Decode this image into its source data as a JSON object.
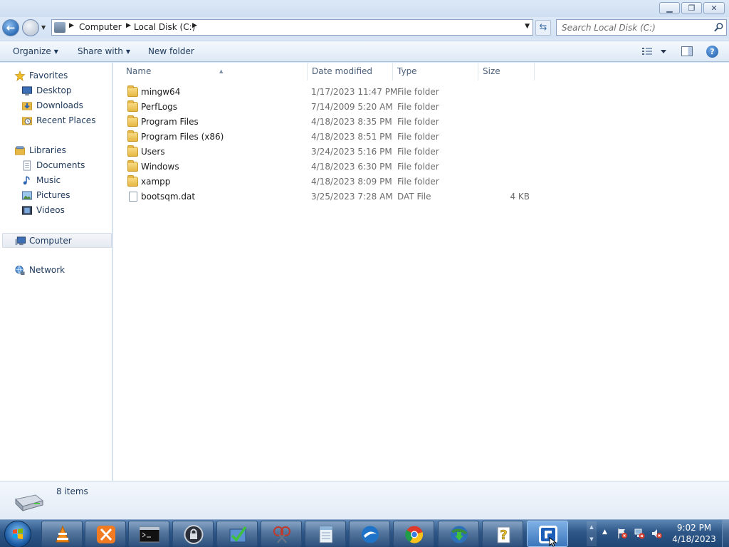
{
  "window": {
    "min_glyph": "▁",
    "max_glyph": "❐",
    "close_glyph": "✕"
  },
  "address": {
    "crumbs": [
      "Computer",
      "Local Disk (C:)"
    ],
    "search_placeholder": "Search Local Disk (C:)"
  },
  "toolbar": {
    "organize": "Organize",
    "share_with": "Share with",
    "new_folder": "New folder",
    "help_glyph": "?"
  },
  "nav": {
    "favorites": "Favorites",
    "desktop": "Desktop",
    "downloads": "Downloads",
    "recent_places": "Recent Places",
    "libraries": "Libraries",
    "documents": "Documents",
    "music": "Music",
    "pictures": "Pictures",
    "videos": "Videos",
    "computer": "Computer",
    "network": "Network"
  },
  "columns": {
    "name": "Name",
    "date_modified": "Date modified",
    "type": "Type",
    "size": "Size"
  },
  "files": [
    {
      "name": "mingw64",
      "date": "1/17/2023 11:47 PM",
      "type": "File folder",
      "size": ""
    },
    {
      "name": "PerfLogs",
      "date": "7/14/2009 5:20 AM",
      "type": "File folder",
      "size": ""
    },
    {
      "name": "Program Files",
      "date": "4/18/2023 8:35 PM",
      "type": "File folder",
      "size": ""
    },
    {
      "name": "Program Files (x86)",
      "date": "4/18/2023 8:51 PM",
      "type": "File folder",
      "size": ""
    },
    {
      "name": "Users",
      "date": "3/24/2023 5:16 PM",
      "type": "File folder",
      "size": ""
    },
    {
      "name": "Windows",
      "date": "4/18/2023 6:30 PM",
      "type": "File folder",
      "size": ""
    },
    {
      "name": "xampp",
      "date": "4/18/2023 8:09 PM",
      "type": "File folder",
      "size": ""
    },
    {
      "name": "bootsqm.dat",
      "date": "3/25/2023 7:28 AM",
      "type": "DAT File",
      "size": "4 KB"
    }
  ],
  "details": {
    "item_count": "8 items"
  },
  "taskbar": {
    "apps": [
      {
        "name": "vlc-icon",
        "color": "#f28a1c"
      },
      {
        "name": "xampp-icon",
        "color": "#f27a20"
      },
      {
        "name": "cmd-icon",
        "color": "#111111"
      },
      {
        "name": "lock-app-icon",
        "color": "#2a2f3a"
      },
      {
        "name": "check-app-icon",
        "color": "#3a8a3a"
      },
      {
        "name": "snipping-tool-icon",
        "color": "#c9d3df"
      },
      {
        "name": "notepad-app-icon",
        "color": "#8fb5d8"
      },
      {
        "name": "openoffice-icon",
        "color": "#1e73c8"
      },
      {
        "name": "chrome-icon",
        "color": "#dd3a2c"
      },
      {
        "name": "download-manager-icon",
        "color": "#3a8c3f"
      },
      {
        "name": "help-app-icon",
        "color": "#e7c233"
      },
      {
        "name": "active-app-icon",
        "color": "#1d5fb8"
      }
    ],
    "time": "9:02 PM",
    "date": "4/18/2023"
  },
  "colors": {
    "accent": "#3a6ea5",
    "folder": "#e6b845"
  }
}
